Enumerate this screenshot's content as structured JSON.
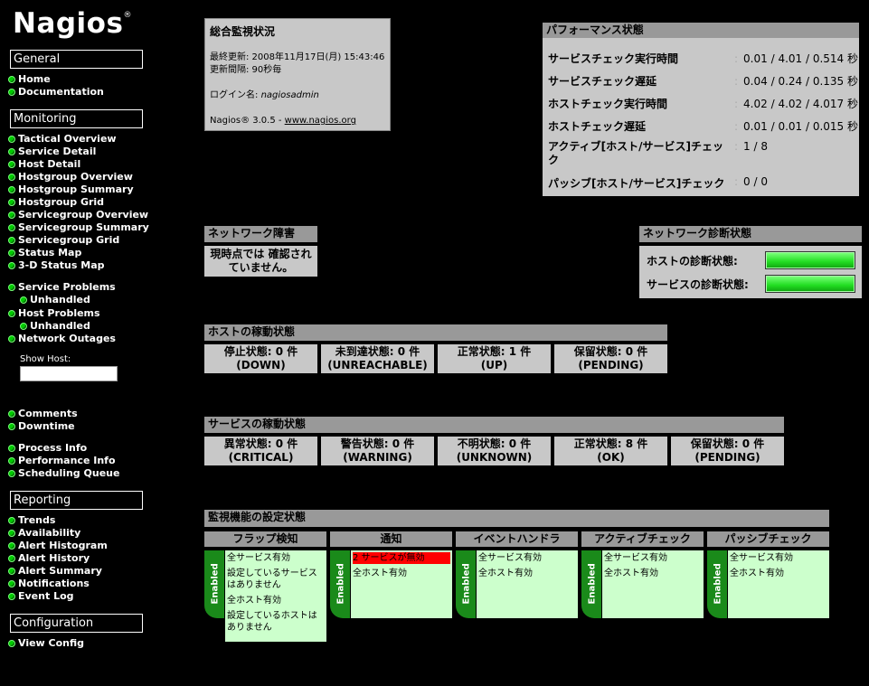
{
  "logo": "Nagios",
  "sidebar": {
    "general": {
      "title": "General",
      "items": [
        "Home",
        "Documentation"
      ]
    },
    "monitoring": {
      "title": "Monitoring",
      "items": [
        "Tactical Overview",
        "Service Detail",
        "Host Detail",
        "Hostgroup Overview",
        "Hostgroup Summary",
        "Hostgroup Grid",
        "Servicegroup Overview",
        "Servicegroup Summary",
        "Servicegroup Grid",
        "Status Map",
        "3-D Status Map"
      ]
    },
    "problems": {
      "service": "Service Problems",
      "service_unhandled": "Unhandled",
      "host": "Host Problems",
      "host_unhandled": "Unhandled",
      "outages": "Network Outages"
    },
    "show_host": "Show Host:",
    "misc": [
      "Comments",
      "Downtime"
    ],
    "process": [
      "Process Info",
      "Performance Info",
      "Scheduling Queue"
    ],
    "reporting": {
      "title": "Reporting",
      "items": [
        "Trends",
        "Availability",
        "Alert Histogram",
        "Alert History",
        "Alert Summary",
        "Notifications",
        "Event Log"
      ]
    },
    "configuration": {
      "title": "Configuration",
      "items": [
        "View Config"
      ]
    }
  },
  "info": {
    "title": "総合監視状況",
    "last_update": "最終更新: 2008年11月17日(月) 15:43:46",
    "interval": "更新間隔: 90秒毎",
    "login_label": "ログイン名: ",
    "login_user": "nagiosadmin",
    "version_prefix": "Nagios® 3.0.5 - ",
    "version_link": "www.nagios.org"
  },
  "performance": {
    "title": "パフォーマンス状態",
    "rows": [
      {
        "label": "サービスチェック実行時間",
        "value": "0.01 / 4.01 / 0.514 秒"
      },
      {
        "label": "サービスチェック遅延",
        "value": "0.04 / 0.24 / 0.135 秒"
      },
      {
        "label": "ホストチェック実行時間",
        "value": "4.02 / 4.02 / 4.017 秒"
      },
      {
        "label": "ホストチェック遅延",
        "value": "0.01 / 0.01 / 0.015 秒"
      },
      {
        "label": "アクティブ[ホスト/サービス]チェック",
        "value": "1 / 8"
      },
      {
        "label": "パッシブ[ホスト/サービス]チェック",
        "value": "0 / 0"
      }
    ]
  },
  "network_outages": {
    "title": "ネットワーク障害",
    "text1": "現時点では 確認され",
    "text2": "ていません。"
  },
  "network_health": {
    "title": "ネットワーク診断状態",
    "host_label": "ホストの診断状態:",
    "service_label": "サービスの診断状態:",
    "host_level": 1.0,
    "service_level": 1.0
  },
  "hosts": {
    "title": "ホストの稼動状態",
    "cells": [
      {
        "l1": "停止状態: 0 件",
        "l2": "(DOWN)"
      },
      {
        "l1": "未到達状態: 0 件",
        "l2": "(UNREACHABLE)"
      },
      {
        "l1": "正常状態: 1 件",
        "l2": "(UP)"
      },
      {
        "l1": "保留状態: 0 件",
        "l2": "(PENDING)"
      }
    ]
  },
  "services": {
    "title": "サービスの稼動状態",
    "cells": [
      {
        "l1": "異常状態: 0 件",
        "l2": "(CRITICAL)"
      },
      {
        "l1": "警告状態: 0 件",
        "l2": "(WARNING)"
      },
      {
        "l1": "不明状態: 0 件",
        "l2": "(UNKNOWN)"
      },
      {
        "l1": "正常状態: 8 件",
        "l2": "(OK)"
      },
      {
        "l1": "保留状態: 0 件",
        "l2": "(PENDING)"
      }
    ]
  },
  "features": {
    "title": "監視機能の設定状態",
    "tab_label": "Enabled",
    "columns": [
      {
        "title": "フラップ検知",
        "items": [
          "全サービス有効",
          "設定しているサービスはありません",
          "全ホスト有効",
          "設定しているホストはありません"
        ]
      },
      {
        "title": "通知",
        "warn": "2 サービスが無効",
        "items": [
          "全ホスト有効"
        ]
      },
      {
        "title": "イベントハンドラ",
        "items": [
          "全サービス有効",
          "全ホスト有効"
        ]
      },
      {
        "title": "アクティブチェック",
        "items": [
          "全サービス有効",
          "全ホスト有効"
        ]
      },
      {
        "title": "パッシブチェック",
        "items": [
          "全サービス有効",
          "全ホスト有効"
        ]
      }
    ]
  }
}
